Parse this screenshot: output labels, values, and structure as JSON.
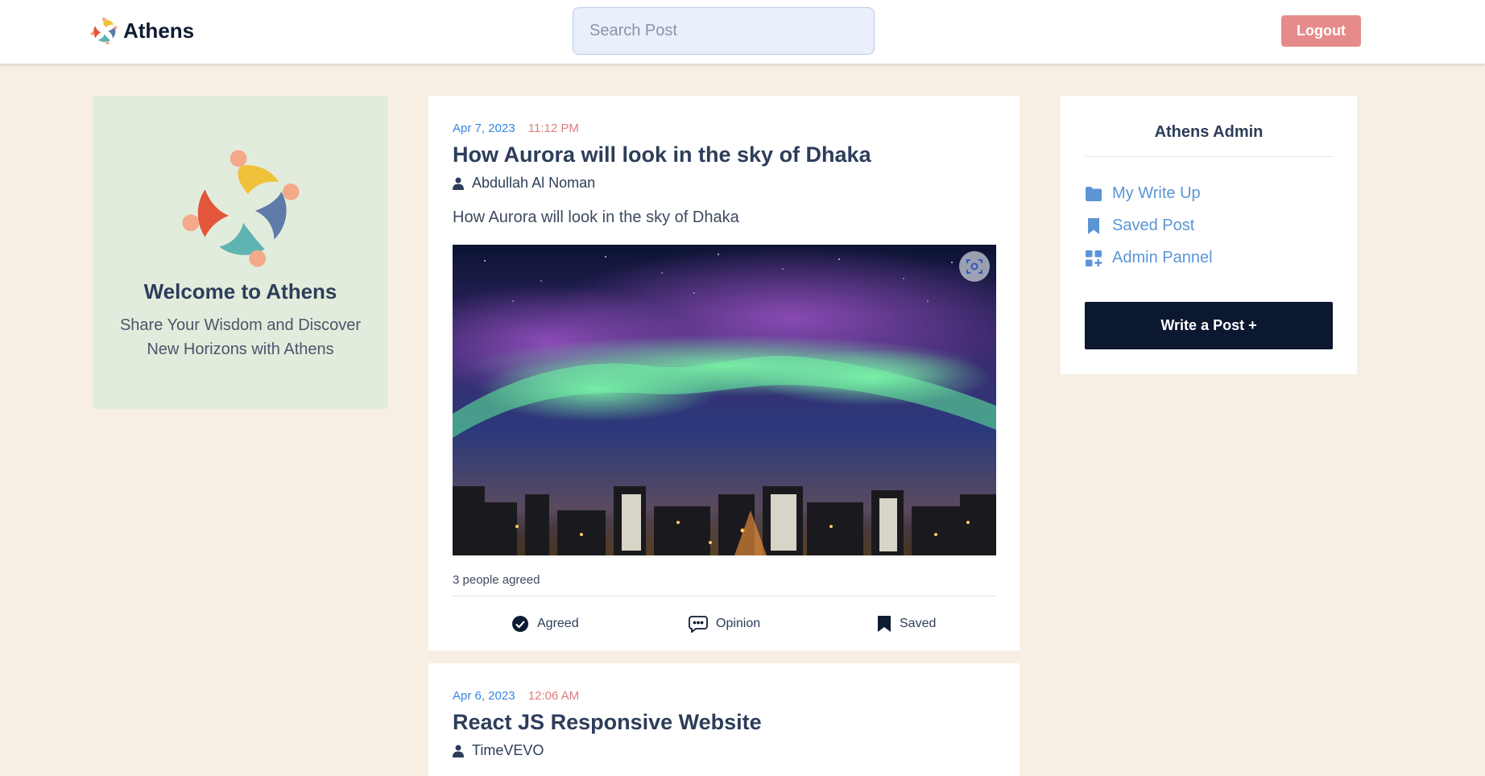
{
  "header": {
    "brand_name": "Athens",
    "search_placeholder": "Search Post",
    "logout_label": "Logout"
  },
  "welcome": {
    "title": "Welcome to Athens",
    "subtitle": "Share Your Wisdom and Discover New Horizons with Athens"
  },
  "posts": [
    {
      "date": "Apr 7, 2023",
      "time": "11:12 PM",
      "title": "How Aurora will look in the sky of Dhaka",
      "author": "Abdullah Al Noman",
      "excerpt": "How Aurora will look in the sky of Dhaka",
      "agreed_count": "3 people agreed",
      "actions": {
        "agreed": "Agreed",
        "opinion": "Opinion",
        "saved": "Saved"
      }
    },
    {
      "date": "Apr 6, 2023",
      "time": "12:06 AM",
      "title": "React JS Responsive Website",
      "author": "TimeVEVO"
    }
  ],
  "sidebar": {
    "title": "Athens Admin",
    "items": [
      {
        "label": "My Write Up",
        "icon": "folder-icon"
      },
      {
        "label": "Saved Post",
        "icon": "bookmark-icon"
      },
      {
        "label": "Admin Pannel",
        "icon": "grid-plus-icon"
      }
    ],
    "write_label": "Write a Post +"
  },
  "colors": {
    "page_bg": "#f7efe4",
    "welcome_bg": "#e2ecdc",
    "accent_blue": "#3a86e0",
    "time_red": "#e27c7c",
    "logout_bg": "#e58b8b",
    "write_bg": "#0c1730"
  }
}
